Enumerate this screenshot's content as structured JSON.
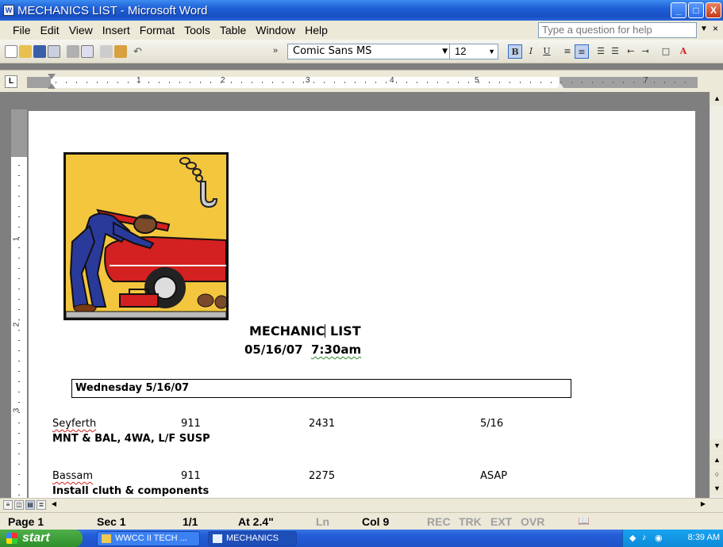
{
  "window": {
    "title": "MECHANICS LIST - Microsoft Word",
    "minimize": "_",
    "maximize": "□",
    "close": "X"
  },
  "menu": {
    "items": [
      "File",
      "Edit",
      "View",
      "Insert",
      "Format",
      "Tools",
      "Table",
      "Window",
      "Help"
    ],
    "help_placeholder": "Type a question for help"
  },
  "toolbar": {
    "font": "Comic Sans MS",
    "size": "12",
    "bold": "B",
    "italic": "I",
    "underline": "U"
  },
  "ruler": {
    "numbers": [
      "1",
      "2",
      "3",
      "4",
      "5",
      "7"
    ]
  },
  "document": {
    "title_part1": "MECHANIC",
    "title_part2": " LIST",
    "date": "05/16/07",
    "time": "7:30am",
    "day_header": "Wednesday 5/16/07",
    "records": [
      {
        "name": "Seyferth",
        "unit": "911",
        "number": "2431",
        "due": "5/16",
        "desc": "MNT & BAL, 4WA, L/F SUSP"
      },
      {
        "name": "Bassam",
        "unit": "911",
        "number": "2275",
        "due": "ASAP",
        "desc": "Install cluth & components"
      }
    ]
  },
  "statusbar": {
    "page": "Page 1",
    "sec": "Sec 1",
    "pages": "1/1",
    "at": "At 2.4\"",
    "ln": "Ln",
    "col": "Col 9",
    "rec": "REC",
    "trk": "TRK",
    "ext": "EXT",
    "ovr": "OVR"
  },
  "taskbar": {
    "start": "start",
    "tasks": [
      "WWCC II TECH ...",
      "MECHANICS LIS..."
    ],
    "clock": "8:39 AM"
  },
  "colors": {
    "titlebar": "#1f5fd6",
    "chrome": "#ece9d8",
    "taskbar": "#245ed8",
    "start": "#2f8f2b"
  }
}
